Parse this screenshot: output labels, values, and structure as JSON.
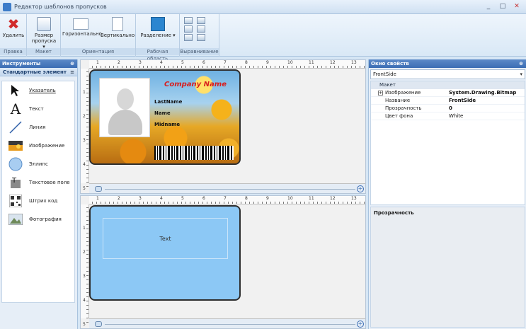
{
  "window": {
    "title": "Редактор шаблонов пропусков",
    "min": "_",
    "max": "□",
    "close": "✕"
  },
  "ribbon": {
    "groups": [
      {
        "label": "Правка",
        "buttons": [
          {
            "label": "Удалить"
          }
        ]
      },
      {
        "label": "Макет",
        "buttons": [
          {
            "label": "Размер пропуска ▾"
          }
        ]
      },
      {
        "label": "Ориентация",
        "buttons": [
          {
            "label": "Горизонтально"
          },
          {
            "label": "Вертикально"
          }
        ]
      },
      {
        "label": "Рабочая область",
        "buttons": [
          {
            "label": "Разделение ▾"
          }
        ]
      },
      {
        "label": "Выравнивание",
        "buttons": []
      }
    ]
  },
  "tools_panel": {
    "title": "Инструменты",
    "section": "Стандартные элемент",
    "items": [
      {
        "label": "Указатель",
        "icon": "pointer-icon"
      },
      {
        "label": "Текст",
        "icon": "text-icon"
      },
      {
        "label": "Линия",
        "icon": "line-icon"
      },
      {
        "label": "Изображение",
        "icon": "image-icon"
      },
      {
        "label": "Эллипс",
        "icon": "ellipse-icon"
      },
      {
        "label": "Текстовое поле",
        "icon": "textfield-icon"
      },
      {
        "label": "Штрих код",
        "icon": "barcode-icon"
      },
      {
        "label": "Фотография",
        "icon": "photo-icon"
      }
    ]
  },
  "ruler": {
    "h": [
      "1",
      "2",
      "3",
      "4",
      "5",
      "6",
      "7",
      "8",
      "9",
      "10",
      "11",
      "12",
      "13"
    ],
    "v1": [
      "1",
      "2",
      "3",
      "4",
      "5"
    ],
    "v2": [
      "1",
      "2",
      "3",
      "4",
      "5"
    ]
  },
  "front_card": {
    "company": "Company Name",
    "fields": [
      "LastName",
      "Name",
      "Midname"
    ]
  },
  "back_card": {
    "text": "Text"
  },
  "properties": {
    "title": "Окно свойств",
    "selected": "FrontSide",
    "category": "Макет",
    "rows": [
      {
        "key": "Изображение",
        "value": "System.Drawing.Bitmap",
        "expandable": true,
        "bold": true
      },
      {
        "key": "Название",
        "value": "FrontSide",
        "bold": true
      },
      {
        "key": "Прозрачность",
        "value": "0",
        "bold": true
      },
      {
        "key": "Цвет фона",
        "value": "White",
        "bold": false
      }
    ],
    "description_title": "Прозрачность"
  },
  "colors": {
    "accent": "#3b6db4",
    "card_back": "#8cc8f5",
    "company_red": "#d81d1d"
  }
}
